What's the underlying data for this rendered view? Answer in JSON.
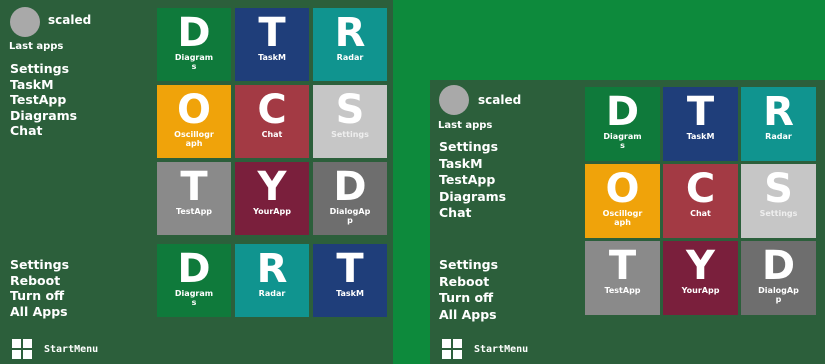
{
  "colors": {
    "background": "#0d8a3c",
    "pane": "#2c5f3b",
    "tile_darkgreen": "#0f7a3b",
    "tile_navy": "#1f3e7a",
    "tile_teal": "#10948f",
    "tile_orange": "#f0a30a",
    "tile_red": "#a33a44",
    "tile_lightgray": "#c6c6c6",
    "tile_gray": "#8a8a8a",
    "tile_maroon": "#7a1f3c",
    "tile_darkgray": "#6e6e6e"
  },
  "left": {
    "username": "scaled",
    "last_apps_label": "Last apps",
    "last_apps": [
      "Settings",
      "TaskM",
      "TestApp",
      "Diagrams",
      "Chat"
    ],
    "system_items": [
      "Settings",
      "Reboot",
      "Turn off",
      "All Apps"
    ],
    "tiles": [
      {
        "letter": "D",
        "label": "Diagrams",
        "color": "#0f7a3b"
      },
      {
        "letter": "T",
        "label": "TaskM",
        "color": "#1f3e7a"
      },
      {
        "letter": "R",
        "label": "Radar",
        "color": "#10948f"
      },
      {
        "letter": "O",
        "label": "Oscillograph",
        "color": "#f0a30a"
      },
      {
        "letter": "C",
        "label": "Chat",
        "color": "#a33a44"
      },
      {
        "letter": "S",
        "label": "Settings",
        "color": "#c6c6c6"
      },
      {
        "letter": "T",
        "label": "TestApp",
        "color": "#8a8a8a"
      },
      {
        "letter": "Y",
        "label": "YourApp",
        "color": "#7a1f3c"
      },
      {
        "letter": "D",
        "label": "DialogApp",
        "color": "#6e6e6e"
      }
    ],
    "tiles_bottom": [
      {
        "letter": "D",
        "label": "Diagrams",
        "color": "#0f7a3b"
      },
      {
        "letter": "R",
        "label": "Radar",
        "color": "#10948f"
      },
      {
        "letter": "T",
        "label": "TaskM",
        "color": "#1f3e7a"
      }
    ]
  },
  "right": {
    "username": "scaled",
    "last_apps_label": "Last apps",
    "last_apps": [
      "Settings",
      "TaskM",
      "TestApp",
      "Diagrams",
      "Chat"
    ],
    "system_items": [
      "Settings",
      "Reboot",
      "Turn off",
      "All Apps"
    ],
    "tiles": [
      {
        "letter": "D",
        "label": "Diagrams",
        "color": "#0f7a3b"
      },
      {
        "letter": "T",
        "label": "TaskM",
        "color": "#1f3e7a"
      },
      {
        "letter": "R",
        "label": "Radar",
        "color": "#10948f"
      },
      {
        "letter": "O",
        "label": "Oscillograph",
        "color": "#f0a30a"
      },
      {
        "letter": "C",
        "label": "Chat",
        "color": "#a33a44"
      },
      {
        "letter": "S",
        "label": "Settings",
        "color": "#c6c6c6"
      },
      {
        "letter": "T",
        "label": "TestApp",
        "color": "#8a8a8a"
      },
      {
        "letter": "Y",
        "label": "YourApp",
        "color": "#7a1f3c"
      },
      {
        "letter": "D",
        "label": "DialogApp",
        "color": "#6e6e6e"
      }
    ]
  },
  "taskbar": {
    "start_label": "StartMenu",
    "icon": "windows-grid-icon"
  }
}
